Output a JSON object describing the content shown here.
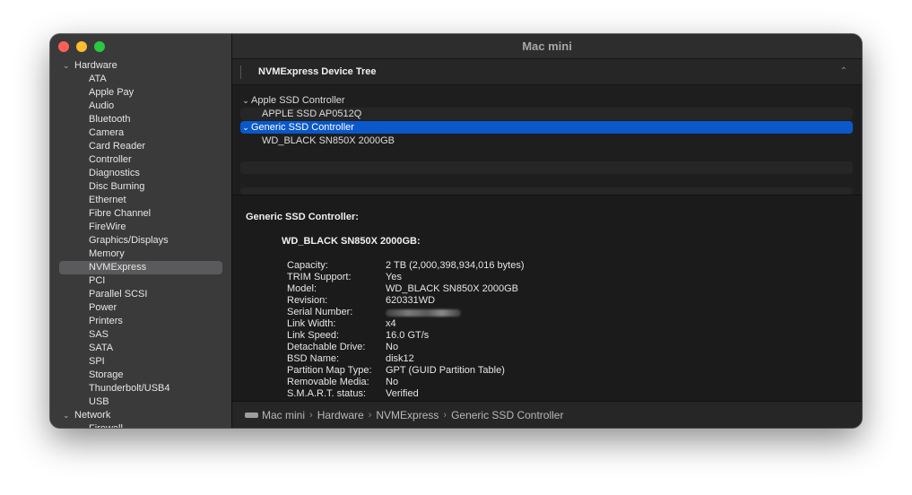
{
  "window": {
    "title": "Mac mini"
  },
  "sidebar": {
    "groups": [
      {
        "label": "Hardware",
        "items": [
          "ATA",
          "Apple Pay",
          "Audio",
          "Bluetooth",
          "Camera",
          "Card Reader",
          "Controller",
          "Diagnostics",
          "Disc Burning",
          "Ethernet",
          "Fibre Channel",
          "FireWire",
          "Graphics/Displays",
          "Memory",
          "NVMExpress",
          "PCI",
          "Parallel SCSI",
          "Power",
          "Printers",
          "SAS",
          "SATA",
          "SPI",
          "Storage",
          "Thunderbolt/USB4",
          "USB"
        ]
      },
      {
        "label": "Network",
        "items": [
          "Firewall"
        ]
      }
    ],
    "selected": "NVMExpress"
  },
  "section": {
    "title": "NVMExpress Device Tree"
  },
  "device_tree": [
    {
      "label": "Apple SSD Controller",
      "expanded": true,
      "selected": false
    },
    {
      "label": "APPLE SSD AP0512Q",
      "child": true
    },
    {
      "label": "Generic SSD Controller",
      "expanded": true,
      "selected": true
    },
    {
      "label": "WD_BLACK SN850X 2000GB",
      "child": true
    }
  ],
  "details": {
    "title": "Generic SSD Controller:",
    "subtitle": "WD_BLACK SN850X 2000GB:",
    "properties": [
      {
        "key": "Capacity:",
        "value": "2 TB (2,000,398,934,016 bytes)"
      },
      {
        "key": "TRIM Support:",
        "value": "Yes"
      },
      {
        "key": "Model:",
        "value": "WD_BLACK SN850X 2000GB"
      },
      {
        "key": "Revision:",
        "value": "620331WD"
      },
      {
        "key": "Serial Number:",
        "value": "",
        "redacted": true
      },
      {
        "key": "Link Width:",
        "value": "x4"
      },
      {
        "key": "Link Speed:",
        "value": "16.0 GT/s"
      },
      {
        "key": "Detachable Drive:",
        "value": "No"
      },
      {
        "key": "BSD Name:",
        "value": "disk12"
      },
      {
        "key": "Partition Map Type:",
        "value": "GPT (GUID Partition Table)"
      },
      {
        "key": "Removable Media:",
        "value": "No"
      },
      {
        "key": "S.M.A.R.T. status:",
        "value": "Verified"
      }
    ]
  },
  "pathbar": {
    "icon": "mac-mini-icon",
    "crumbs": [
      "Mac mini",
      "Hardware",
      "NVMExpress",
      "Generic SSD Controller"
    ]
  },
  "colors": {
    "selection": "#0a58ca",
    "sidebar_selection": "#5a5a5c",
    "close": "#fe5f57",
    "minimize": "#febc2e",
    "zoom": "#28c840"
  }
}
